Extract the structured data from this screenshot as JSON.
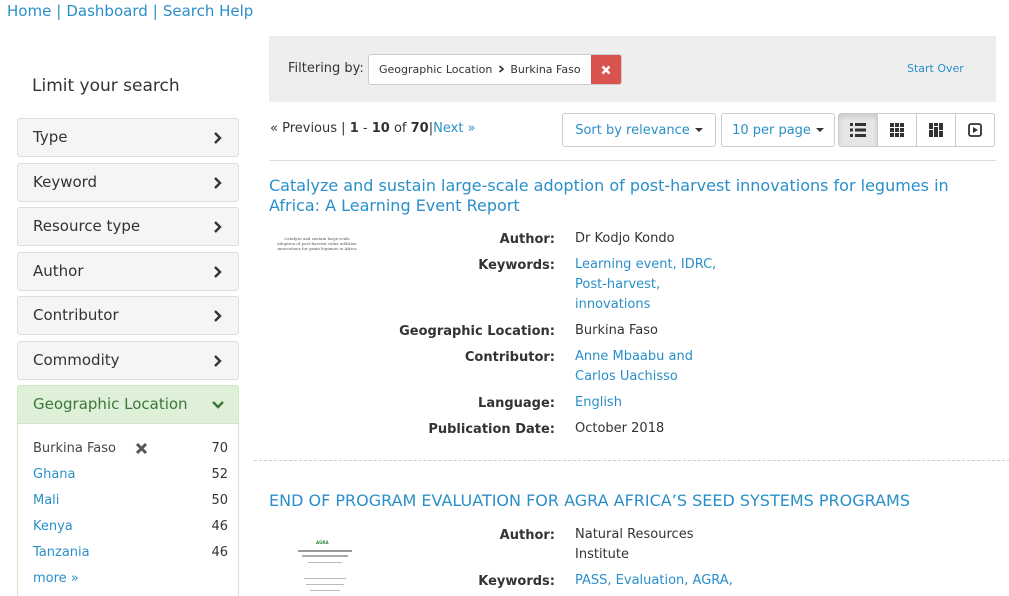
{
  "breadcrumb": {
    "home": "Home",
    "dashboard": "Dashboard",
    "search_help": "Search Help",
    "sep": "|"
  },
  "sidebar": {
    "title": "Limit your search",
    "facets": [
      "Type",
      "Keyword",
      "Resource type",
      "Author",
      "Contributor",
      "Commodity",
      "Geographic Location"
    ],
    "geo_values": [
      {
        "label": "Burkina Faso",
        "count": "70",
        "selected": true
      },
      {
        "label": "Ghana",
        "count": "52"
      },
      {
        "label": "Mali",
        "count": "50"
      },
      {
        "label": "Kenya",
        "count": "46"
      },
      {
        "label": "Tanzania",
        "count": "46"
      }
    ],
    "more": "more »"
  },
  "filter": {
    "label": "Filtering by:",
    "field": "Geographic Location",
    "value": "Burkina Faso",
    "remove_icon": "close-icon",
    "start_over": "Start Over"
  },
  "pagination": {
    "previous": "« Previous",
    "sep": "|",
    "start": "1",
    "dash": "-",
    "end": "10",
    "of": "of",
    "total": "70",
    "next": "Next »"
  },
  "toolbar": {
    "sort": "Sort by relevance",
    "per_page": "10 per page",
    "views": [
      "list-view-icon",
      "gallery-view-icon",
      "masonry-view-icon",
      "slideshow-view-icon"
    ]
  },
  "documents": [
    {
      "title": "Catalyze and sustain large-scale adoption of post-harvest innovations for legumes in Africa: A Learning Event Report",
      "thumb_text": "Catalyze and sustain large-scale adoption of post-harvest value addition innovations for grain legumes in Africa",
      "fields": {
        "author_label": "Author:",
        "author": "Dr Kodjo Kondo",
        "keywords_label": "Keywords:",
        "kw1": "Learning event, IDRC,",
        "kw2": "Post-harvest,",
        "kw3": "innovations",
        "geo_label": "Geographic Location:",
        "geo": "Burkina Faso",
        "contrib_label": "Contributor:",
        "c1": "Anne Mbaabu and",
        "c2": "Carlos Uachisso",
        "lang_label": "Language:",
        "lang": "English",
        "date_label": "Publication Date:",
        "date": "October 2018"
      }
    },
    {
      "title": "END OF PROGRAM EVALUATION FOR AGRA AFRICA’S SEED SYSTEMS PROGRAMS",
      "thumb_logo": "AGRA",
      "fields": {
        "author_label": "Author:",
        "author1": "Natural Resources",
        "author2": "Institute",
        "keywords_label": "Keywords:",
        "kw1": "PASS, Evaluation, AGRA,"
      }
    }
  ],
  "colors": {
    "link": "#2a8fc9",
    "facet_open_bg": "#dff0d8",
    "facet_open_text": "#3c763d",
    "remove": "#d9534f"
  }
}
